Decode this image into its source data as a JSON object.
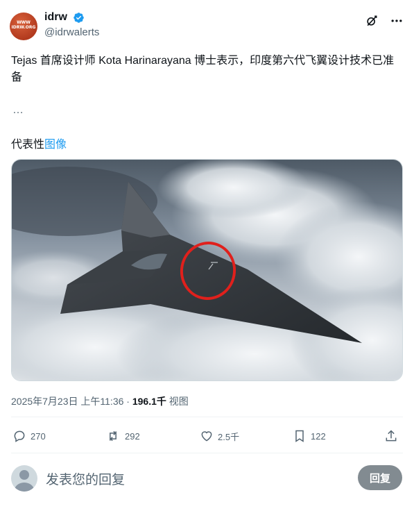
{
  "author": {
    "display_name": "idrw",
    "handle": "@idrwalerts",
    "avatar_logo_text": [
      "WWW",
      "IDRW.ORG"
    ],
    "verified": true
  },
  "header_icons": [
    "grok-icon",
    "more-icon"
  ],
  "post": {
    "text": "Tejas 首席设计师 Kota Harinarayana 博士表示，印度第六代飞翼设计技术已准备",
    "ellipsis": "…",
    "caption_prefix": "代表性",
    "caption_link": "图像"
  },
  "meta": {
    "timestamp": "2025年7月23日 上午11:36 · ",
    "views_count": "196.1千",
    "views_label": " 视图"
  },
  "actions": {
    "replies": "270",
    "reposts": "292",
    "likes": "2.5千",
    "bookmarks": "122"
  },
  "reply_box": {
    "placeholder": "发表您的回复",
    "button_label": "回复"
  },
  "colors": {
    "accent": "#1d9bf0",
    "secondary_text": "#536471",
    "reply_button": "#828b91"
  }
}
